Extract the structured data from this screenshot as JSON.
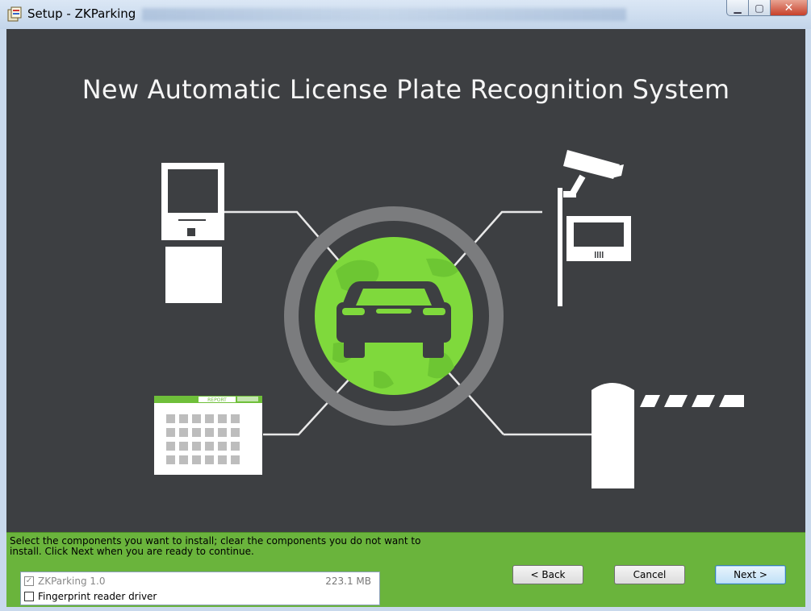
{
  "window": {
    "title": "Setup - ZKParking"
  },
  "banner": {
    "title": "New Automatic License Plate Recognition System",
    "report_label": "REPORT"
  },
  "footer": {
    "instruction_line1": "Select the components you want to install; clear the components you do not want to",
    "instruction_line2": "install. Click Next when you are ready to continue.",
    "components": [
      {
        "label": "ZKParking 1.0",
        "size": "223.1 MB",
        "checked": true,
        "disabled": true
      },
      {
        "label": "Fingerprint reader driver",
        "size": "",
        "checked": false,
        "disabled": false
      }
    ],
    "buttons": {
      "back": "< Back",
      "cancel": "Cancel",
      "next": "Next >"
    }
  },
  "colors": {
    "banner_bg": "#3d3f42",
    "footer_bg": "#6ab43c",
    "globe_green": "#7fd93c"
  }
}
